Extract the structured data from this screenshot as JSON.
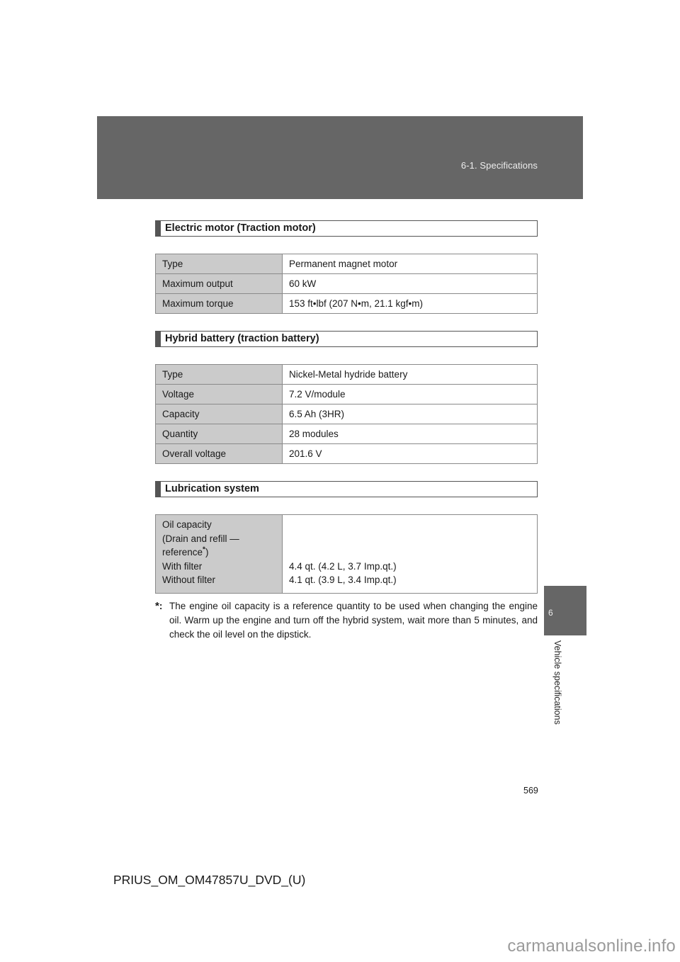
{
  "header": {
    "breadcrumb": "6-1. Specifications"
  },
  "side_tab": {
    "chapter_number": "6",
    "chapter_label": "Vehicle specifications"
  },
  "sections": [
    {
      "title": "Electric motor (Traction motor)",
      "rows": [
        {
          "label": "Type",
          "value": "Permanent magnet motor"
        },
        {
          "label": "Maximum output",
          "value": "60 kW"
        },
        {
          "label": "Maximum torque",
          "value": "153 ft•lbf (207 N•m, 21.1 kgf•m)"
        }
      ]
    },
    {
      "title": "Hybrid battery (traction battery)",
      "rows": [
        {
          "label": "Type",
          "value": "Nickel-Metal hydride battery"
        },
        {
          "label": "Voltage",
          "value": "7.2 V/module"
        },
        {
          "label": "Capacity",
          "value": "6.5 Ah (3HR)"
        },
        {
          "label": "Quantity",
          "value": "28 modules"
        },
        {
          "label": "Overall voltage",
          "value": "201.6 V"
        }
      ]
    },
    {
      "title": "Lubrication system",
      "oil": {
        "label_line1": "Oil capacity",
        "label_line2": "(Drain and refill —",
        "label_line3_pre": "reference",
        "label_line3_mark": "*",
        "label_line3_post": ")",
        "with_filter_label": "With filter",
        "without_filter_label": "Without filter",
        "with_filter_value": "4.4 qt. (4.2 L, 3.7 Imp.qt.)",
        "without_filter_value": "4.1 qt. (3.9 L, 3.4 Imp.qt.)"
      }
    }
  ],
  "footnote": {
    "mark": "*",
    "separator": ":",
    "text": "The engine oil capacity is a reference quantity to be used when changing the engine oil. Warm up the engine and turn off the hybrid system, wait more than 5 minutes, and check the oil level on the dipstick."
  },
  "page_number": "569",
  "document_id": "PRIUS_OM_OM47857U_DVD_(U)",
  "watermark": "carmanualsonline.info"
}
